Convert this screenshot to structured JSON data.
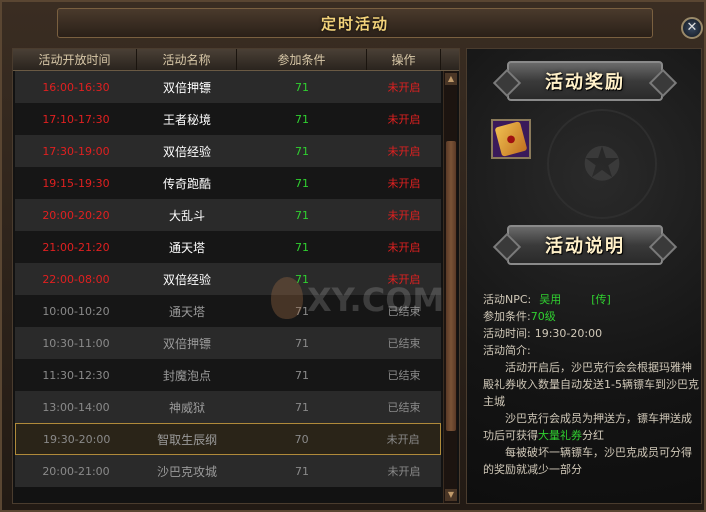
{
  "window": {
    "title": "定时活动",
    "close_label": "✕"
  },
  "table": {
    "headers": [
      "活动开放时间",
      "活动名称",
      "参加条件",
      "操作"
    ],
    "rows": [
      {
        "time": "16:00-16:30",
        "name": "双倍押镖",
        "level": "71",
        "status": "未开启",
        "style": "active"
      },
      {
        "time": "17:10-17:30",
        "name": "王者秘境",
        "level": "71",
        "status": "未开启",
        "style": "active"
      },
      {
        "time": "17:30-19:00",
        "name": "双倍经验",
        "level": "71",
        "status": "未开启",
        "style": "active"
      },
      {
        "time": "19:15-19:30",
        "name": "传奇跑酷",
        "level": "71",
        "status": "未开启",
        "style": "active"
      },
      {
        "time": "20:00-20:20",
        "name": "大乱斗",
        "level": "71",
        "status": "未开启",
        "style": "active"
      },
      {
        "time": "21:00-21:20",
        "name": "通天塔",
        "level": "71",
        "status": "未开启",
        "style": "active"
      },
      {
        "time": "22:00-08:00",
        "name": "双倍经验",
        "level": "71",
        "status": "未开启",
        "style": "active"
      },
      {
        "time": "10:00-10:20",
        "name": "通天塔",
        "level": "71",
        "status": "已结束",
        "style": "ended"
      },
      {
        "time": "10:30-11:00",
        "name": "双倍押镖",
        "level": "71",
        "status": "已结束",
        "style": "ended"
      },
      {
        "time": "11:30-12:30",
        "name": "封魔泡点",
        "level": "71",
        "status": "已结束",
        "style": "ended"
      },
      {
        "time": "13:00-14:00",
        "name": "神威狱",
        "level": "71",
        "status": "已结束",
        "style": "ended"
      },
      {
        "time": "19:30-20:00",
        "name": "智取生辰纲",
        "level": "70",
        "status": "未开启",
        "style": "selected"
      },
      {
        "time": "20:00-21:00",
        "name": "沙巴克攻城",
        "level": "71",
        "status": "未开启",
        "style": "ended"
      }
    ]
  },
  "reward": {
    "heading": "活动奖励"
  },
  "description": {
    "heading": "活动说明",
    "npc_label": "活动NPC:",
    "npc_name": "吴用",
    "npc_link": "[传]",
    "cond_label": "参加条件:",
    "cond_value": "70级",
    "time_label": "活动时间:",
    "time_value": "19:30-20:00",
    "intro_label": "活动简介:",
    "para1": "活动开启后，沙巴克行会会根据玛雅神殿礼券收入数量自动发送1-5辆镖车到沙巴克主城",
    "para2_a": "沙巴克行会成员为押送方，镖车押送成功后可获得",
    "para2_hl": "大量礼券",
    "para2_b": "分红",
    "para3": "每被破坏一辆镖车，沙巴克成员可分得的奖励就减少一部分"
  },
  "watermark": {
    "text": "XY.COM"
  },
  "colors": {
    "active_time": "#e02020",
    "level": "#30d030",
    "ended": "#8a8a8a",
    "title": "#f2d27a"
  }
}
